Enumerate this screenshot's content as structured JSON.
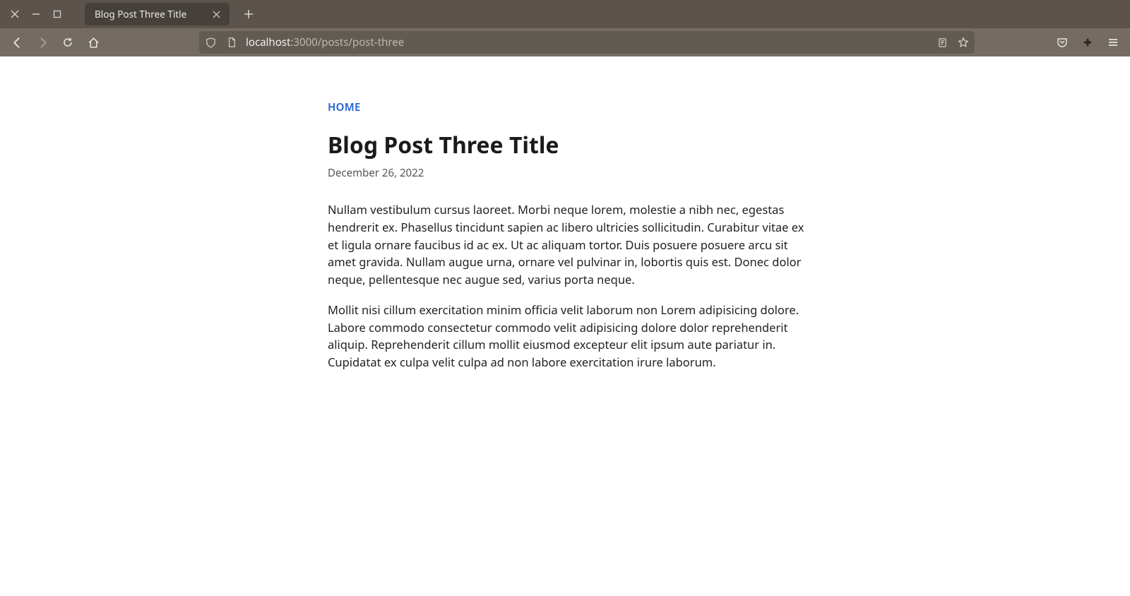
{
  "browser": {
    "tab_title": "Blog Post Three Title",
    "url_host": "localhost",
    "url_path": ":3000/posts/post-three"
  },
  "page": {
    "home_link_label": "HOME",
    "post_title": "Blog Post Three Title",
    "post_date": "December 26, 2022",
    "paragraphs": [
      "Nullam vestibulum cursus laoreet. Morbi neque lorem, molestie a nibh nec, egestas hendrerit ex. Phasellus tincidunt sapien ac libero ultricies sollicitudin. Curabitur vitae ex et ligula ornare faucibus id ac ex. Ut ac aliquam tortor. Duis posuere posuere arcu sit amet gravida. Nullam augue urna, ornare vel pulvinar in, lobortis quis est. Donec dolor neque, pellentesque nec augue sed, varius porta neque.",
      "Mollit nisi cillum exercitation minim officia velit laborum non Lorem adipisicing dolore. Labore commodo consectetur commodo velit adipisicing dolore dolor reprehenderit aliquip. Reprehenderit cillum mollit eiusmod excepteur elit ipsum aute pariatur in. Cupidatat ex culpa velit culpa ad non labore exercitation irure laborum."
    ]
  }
}
